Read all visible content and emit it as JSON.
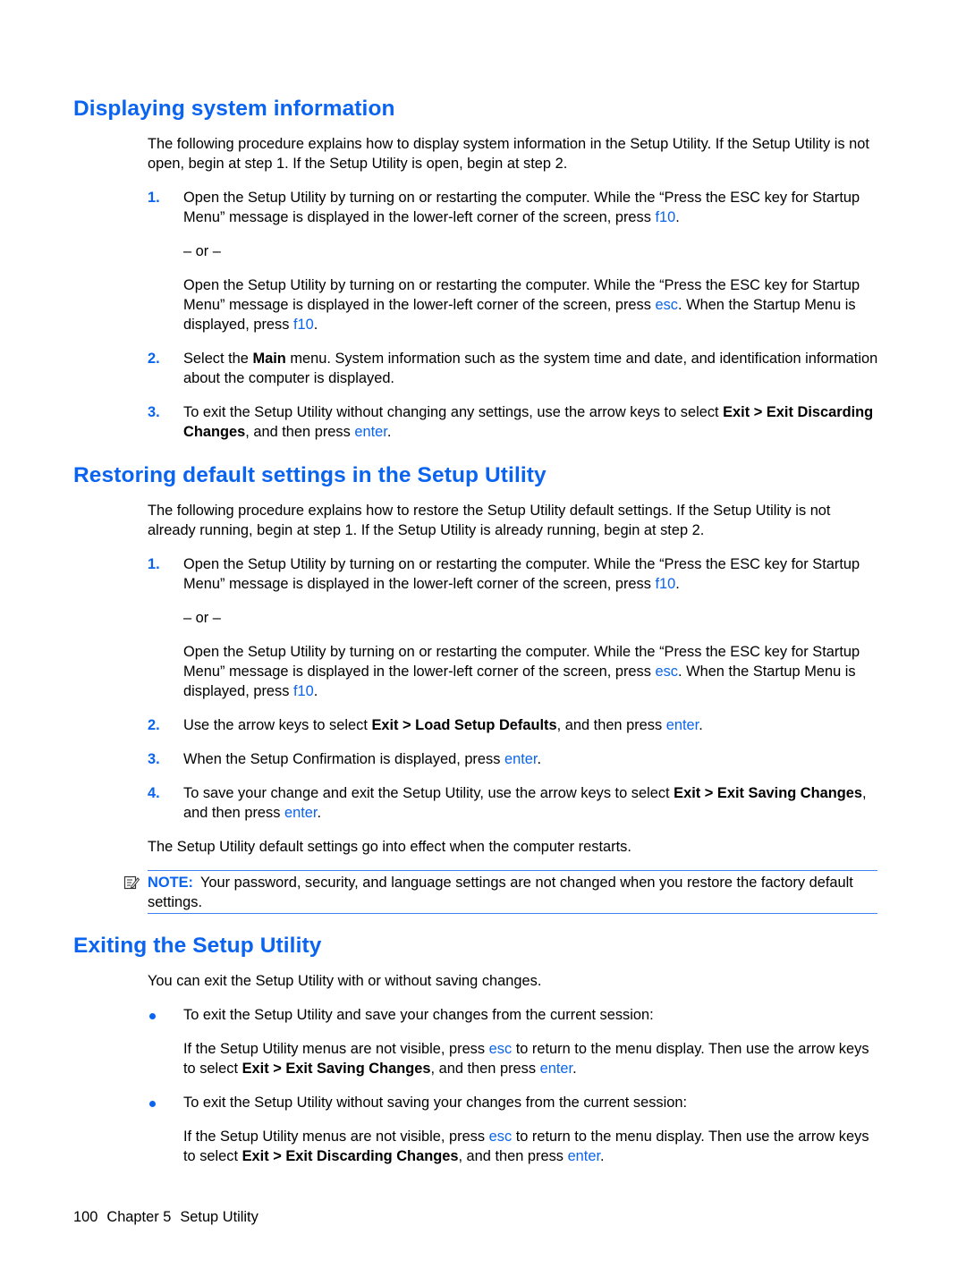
{
  "sections": [
    {
      "title": "Displaying system information",
      "intro": "The following procedure explains how to display system information in the Setup Utility. If the Setup Utility is not open, begin at step 1. If the Setup Utility is open, begin at step 2.",
      "steps": [
        {
          "num": "1.",
          "line1_a": "Open the Setup Utility by turning on or restarting the computer. While the “Press the ESC key for Startup Menu” message is displayed in the lower-left corner of the screen, press ",
          "line1_key": "f10",
          "line1_end": ".",
          "or": "– or –",
          "alt_a": "Open the Setup Utility by turning on or restarting the computer. While the “Press the ESC key for Startup Menu” message is displayed in the lower-left corner of the screen, press ",
          "alt_key1": "esc",
          "alt_b": ". When the Startup Menu is displayed, press ",
          "alt_key2": "f10",
          "alt_end": "."
        },
        {
          "num": "2.",
          "a": "Select the ",
          "bold": "Main",
          "b": " menu. System information such as the system time and date, and identification information about the computer is displayed."
        },
        {
          "num": "3.",
          "a": "To exit the Setup Utility without changing any settings, use the arrow keys to select ",
          "bold": "Exit > Exit Discarding Changes",
          "b": ", and then press ",
          "key": "enter",
          "end": "."
        }
      ]
    },
    {
      "title": "Restoring default settings in the Setup Utility",
      "intro": "The following procedure explains how to restore the Setup Utility default settings. If the Setup Utility is not already running, begin at step 1. If the Setup Utility is already running, begin at step 2.",
      "steps": [
        {
          "num": "1.",
          "line1_a": "Open the Setup Utility by turning on or restarting the computer. While the “Press the ESC key for Startup Menu” message is displayed in the lower-left corner of the screen, press ",
          "line1_key": "f10",
          "line1_end": ".",
          "or": "– or –",
          "alt_a": "Open the Setup Utility by turning on or restarting the computer. While the “Press the ESC key for Startup Menu” message is displayed in the lower-left corner of the screen, press ",
          "alt_key1": "esc",
          "alt_b": ". When the Startup Menu is displayed, press ",
          "alt_key2": "f10",
          "alt_end": "."
        },
        {
          "num": "2.",
          "a": "Use the arrow keys to select ",
          "bold": "Exit > Load Setup Defaults",
          "b": ", and then press ",
          "key": "enter",
          "end": "."
        },
        {
          "num": "3.",
          "a": "When the Setup Confirmation is displayed, press ",
          "key": "enter",
          "end": "."
        },
        {
          "num": "4.",
          "a": "To save your change and exit the Setup Utility, use the arrow keys to select ",
          "bold": "Exit > Exit Saving Changes",
          "b": ", and then press ",
          "key": "enter",
          "end": "."
        }
      ],
      "outro": "The Setup Utility default settings go into effect when the computer restarts.",
      "note": {
        "label": "NOTE:",
        "text": "Your password, security, and language settings are not changed when you restore the factory default settings.",
        "icon": "note-pencil-icon"
      }
    },
    {
      "title": "Exiting the Setup Utility",
      "intro": "You can exit the Setup Utility with or without saving changes.",
      "bullets": [
        {
          "text": "To exit the Setup Utility and save your changes from the current session:",
          "sub_a": "If the Setup Utility menus are not visible, press ",
          "sub_key1": "esc",
          "sub_b": " to return to the menu display. Then use the arrow keys to select ",
          "sub_bold": "Exit > Exit Saving Changes",
          "sub_c": ", and then press ",
          "sub_key2": "enter",
          "sub_end": "."
        },
        {
          "text": "To exit the Setup Utility without saving your changes from the current session:",
          "sub_a": "If the Setup Utility menus are not visible, press ",
          "sub_key1": "esc",
          "sub_b": " to return to the menu display. Then use the arrow keys to select ",
          "sub_bold": "Exit > Exit Discarding Changes",
          "sub_c": ", and then press ",
          "sub_key2": "enter",
          "sub_end": "."
        }
      ]
    }
  ],
  "footer": {
    "page": "100",
    "chapter": "Chapter 5",
    "chapter_title": "Setup Utility"
  }
}
